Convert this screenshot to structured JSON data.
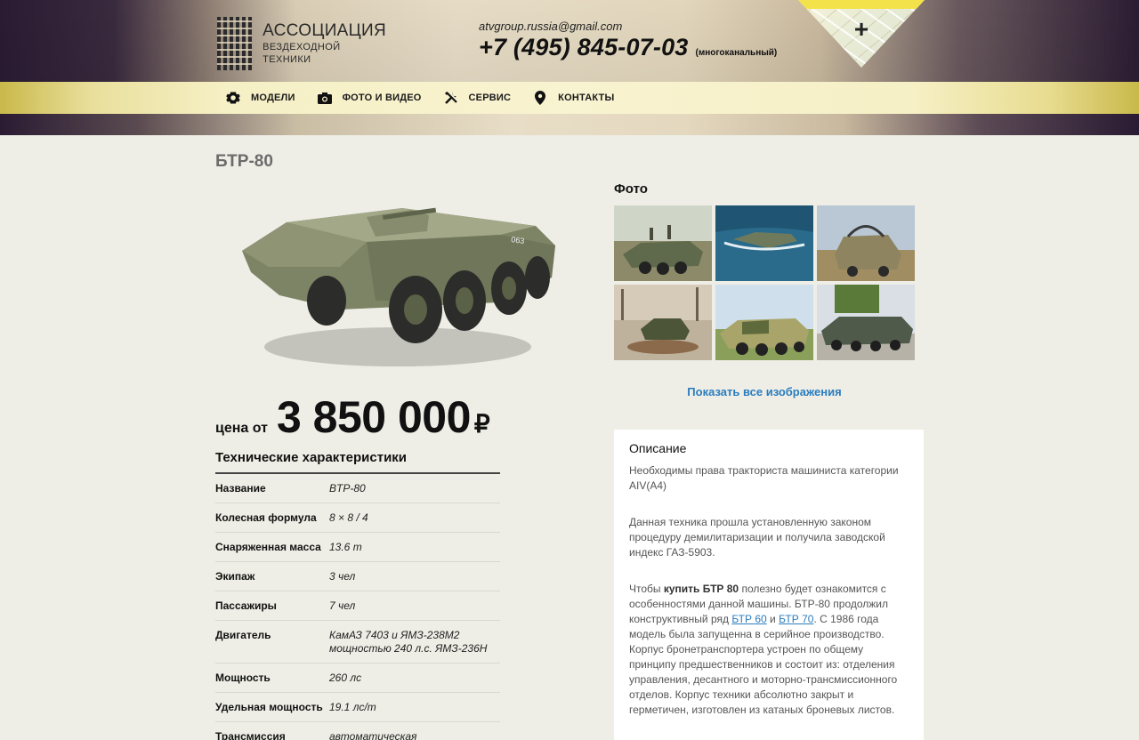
{
  "header": {
    "logo_title": "АССОЦИАЦИЯ",
    "logo_subtitle": "ВЕЗДЕХОДНОЙ ТЕХНИКИ",
    "email": "atvgroup.russia@gmail.com",
    "phone": "+7 (495) 845-07-03",
    "phone_note": "(многоканальный)",
    "map_icon": "plus-icon"
  },
  "nav": {
    "items": [
      {
        "label": "МОДЕЛИ",
        "icon": "gear-icon"
      },
      {
        "label": "ФОТО И ВИДЕО",
        "icon": "camera-icon"
      },
      {
        "label": "СЕРВИС",
        "icon": "tools-icon"
      },
      {
        "label": "КОНТАКТЫ",
        "icon": "location-pin-icon"
      }
    ]
  },
  "product": {
    "title": "БТР-80",
    "image_icon": "armored-vehicle-image",
    "price_prefix": "цена от",
    "price": "3 850 000",
    "currency": "₽"
  },
  "specs": {
    "title": "Технические характеристики",
    "rows": [
      {
        "key": "Название",
        "value": "BTP-80"
      },
      {
        "key": "Колесная формула",
        "value": "8 × 8 / 4"
      },
      {
        "key": "Снаряженная масса",
        "value": "13.6 т"
      },
      {
        "key": "Экипаж",
        "value": "3 чел"
      },
      {
        "key": "Пассажиры",
        "value": "7 чел"
      },
      {
        "key": "Двигатель",
        "value": "КамАЗ 7403 и ЯМЗ-238М2 мощностью 240 л.с. ЯМЗ-236Н"
      },
      {
        "key": "Мощность",
        "value": "260 лс"
      },
      {
        "key": "Удельная мощность",
        "value": "19.1 лс/т"
      },
      {
        "key": "Трансмиссия",
        "value": "автоматическая"
      }
    ]
  },
  "photos": {
    "title": "Фото",
    "show_all": "Показать все изображения",
    "count": 6
  },
  "description": {
    "title": "Описание",
    "p1": "Необходимы права тракториста машиниста категории AIV(A4)",
    "p2": "Данная техника прошла установленную законом процедуру демилитаризации и получила заводской индекс ГАЗ-5903.",
    "p3_a": "Чтобы ",
    "p3_bold": "купить БТР 80",
    "p3_b": " полезно будет ознакомится с особенностями данной машины. БТР-80 продолжил конструктивный ряд ",
    "p3_link1": "БТР 60",
    "p3_c": " и ",
    "p3_link2": "БТР 70",
    "p3_d": ". С 1986 года модель была запущенна в серийное производство. Корпус бронетранспортера устроен по общему принципу предшественников и состоит из: отделения управления, десантного и моторно-трансмиссионного отделов. Корпус техники абсолютно закрыт и герметичен, изготовлен из катаных броневых листов."
  }
}
